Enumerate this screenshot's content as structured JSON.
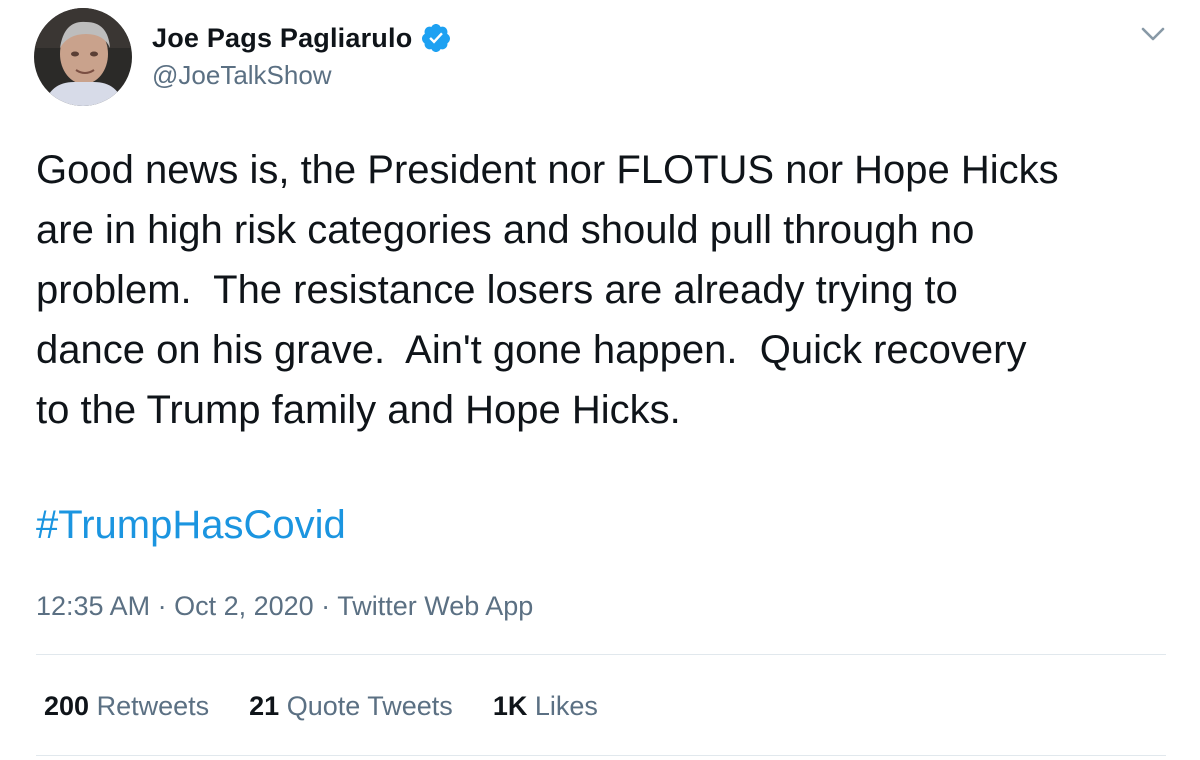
{
  "author": {
    "display_name": "Joe Pags Pagliarulo",
    "handle": "@JoeTalkShow",
    "verified_icon": "verified-badge-icon",
    "avatar": "avatar-photo"
  },
  "menu_icon": "chevron-down-icon",
  "tweet": {
    "text": "Good news is, the President nor FLOTUS nor Hope Hicks\nare in high risk categories and should pull through no\nproblem.  The resistance losers are already trying to\ndance on his grave.  Ain't gone happen.  Quick recovery\nto the Trump family and Hope Hicks.",
    "hashtag": "#TrumpHasCovid"
  },
  "meta": {
    "time": "12:35 AM",
    "separator": " · ",
    "date": "Oct 2, 2020",
    "source": "Twitter Web App"
  },
  "stats": {
    "retweets_count": "200",
    "retweets_label": "Retweets",
    "quotes_count": "21",
    "quotes_label": "Quote Tweets",
    "likes_count": "1K",
    "likes_label": "Likes"
  },
  "colors": {
    "link": "#1b95e0",
    "secondary_text": "#5b7083",
    "verified": "#1da1f2",
    "divider": "#e1e8ed"
  }
}
